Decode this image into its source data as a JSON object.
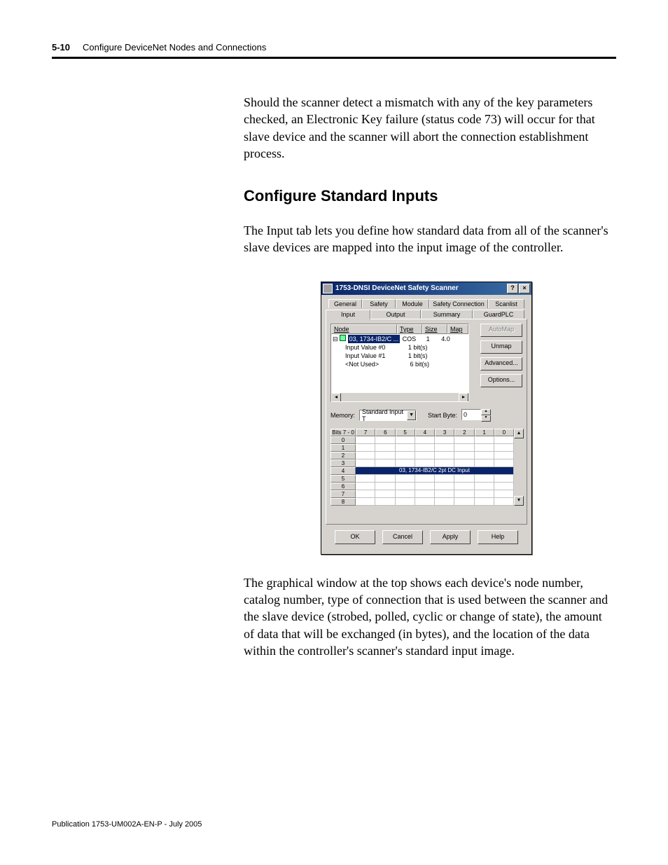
{
  "header": {
    "page_num": "5-10",
    "chapter_title": "Configure DeviceNet Nodes and Connections"
  },
  "body": {
    "para1": "Should the scanner detect a mismatch with any of the key parameters checked, an Electronic Key failure (status code 73) will occur for that slave device and the scanner will abort the connection establishment process.",
    "heading": "Configure Standard Inputs",
    "para2": "The Input tab lets you define how standard data from all of the scanner's slave devices are mapped into the input image of the controller.",
    "para3": "The graphical window at the top shows each device's node number, catalog number, type of connection that is used between the scanner and the slave device (strobed, polled, cyclic or change of state), the amount of data that will be exchanged (in bytes), and the location of the data within the controller's scanner's standard input image."
  },
  "dialog": {
    "title": "1753-DNSI DeviceNet Safety Scanner",
    "title_buttons": {
      "help": "?",
      "close": "×"
    },
    "tabs_back": [
      "General",
      "Safety",
      "Module",
      "Safety Connection",
      "Scanlist"
    ],
    "tabs_front": [
      "Input",
      "Output",
      "Summary",
      "GuardPLC"
    ],
    "tree": {
      "headers": [
        "Node",
        "Type",
        "Size",
        "Map"
      ],
      "root": "03, 1734-IB2/C ...",
      "root_type": "COS",
      "root_size": "1",
      "root_map": "4.0",
      "children": [
        {
          "label": "Input Value #0",
          "size": "1 bit(s)"
        },
        {
          "label": "Input Value #1",
          "size": "1 bit(s)"
        },
        {
          "label": "<Not Used>",
          "size": "6 bit(s)"
        }
      ]
    },
    "side_buttons": {
      "automap": "AutoMap",
      "unmap": "Unmap",
      "advanced": "Advanced...",
      "options": "Options..."
    },
    "memory": {
      "label": "Memory:",
      "combo": "Standard Input T",
      "start_label": "Start Byte:",
      "start_value": "0"
    },
    "grid": {
      "bits_label": "Bits 7 - 0",
      "col_headers": [
        "7",
        "6",
        "5",
        "4",
        "3",
        "2",
        "1",
        "0"
      ],
      "row_labels": [
        "0",
        "1",
        "2",
        "3",
        "4",
        "5",
        "6",
        "7",
        "8"
      ],
      "highlight_row": "4",
      "highlight_text": "03, 1734-IB2/C 2pt DC Input"
    },
    "buttons": {
      "ok": "OK",
      "cancel": "Cancel",
      "apply": "Apply",
      "help": "Help"
    }
  },
  "footer": "Publication 1753-UM002A-EN-P - July 2005"
}
